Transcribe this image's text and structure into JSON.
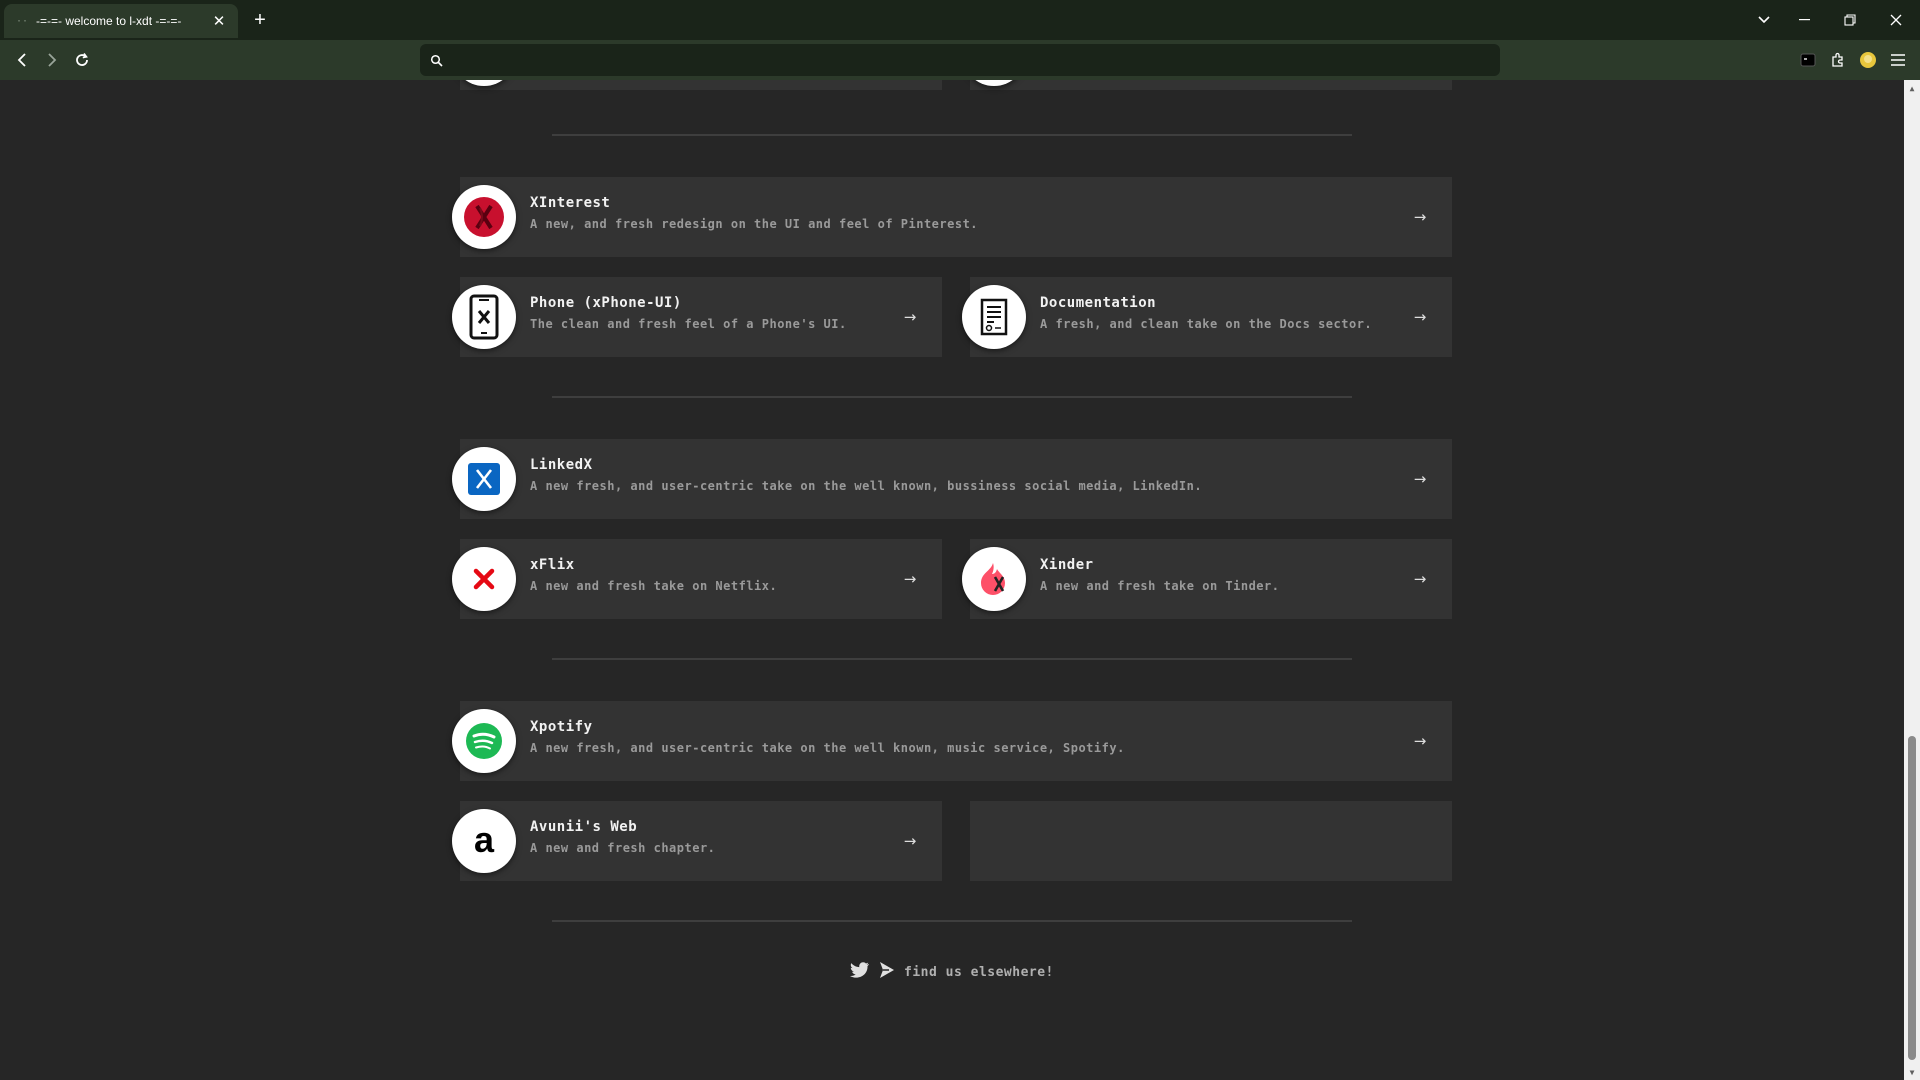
{
  "browser": {
    "tab_title": "-=-=- welcome to l-xdt -=-=-",
    "tab_favicon": "··",
    "new_tab_label": "+",
    "url_value": "",
    "url_placeholder": ""
  },
  "page": {
    "cards": [
      {
        "name": "xinterest",
        "title": "XInterest",
        "description": "A new, and fresh redesign on the UI and feel of Pinterest.",
        "icon": "xinterest-logo-icon"
      },
      {
        "name": "phone-xphone-ui",
        "title": "Phone (xPhone-UI)",
        "description": "The clean and fresh feel of a Phone's UI.",
        "icon": "phone-icon"
      },
      {
        "name": "documentation",
        "title": "Documentation",
        "description": "A fresh, and clean take on the Docs sector.",
        "icon": "document-icon"
      },
      {
        "name": "linkedx",
        "title": "LinkedX",
        "description": "A new fresh, and user-centric take on the well known, bussiness social media, LinkedIn.",
        "icon": "linkedx-logo-icon"
      },
      {
        "name": "xflix",
        "title": "xFlix",
        "description": "A new and fresh take on Netflix.",
        "icon": "xflix-logo-icon"
      },
      {
        "name": "xinder",
        "title": "Xinder",
        "description": "A new and fresh take on Tinder.",
        "icon": "xinder-logo-icon"
      },
      {
        "name": "xpotify",
        "title": "Xpotify",
        "description": "A new fresh, and user-centric take on the well known, music service, Spotify.",
        "icon": "spotify-logo-icon"
      },
      {
        "name": "avunii-web",
        "title": "Avunii's Web",
        "description": "A new and fresh chapter.",
        "icon": "avunii-logo-icon"
      }
    ],
    "footer_text": "find us elsewhere!"
  },
  "colors": {
    "background": "#262626",
    "card": "#333333",
    "chrome_dark": "#1a2419",
    "chrome": "#2c3a2a",
    "xinterest_red": "#c8102e",
    "linkedx_blue": "#0a66c2",
    "xflix_red": "#e50914",
    "xinder_pink": "#fd5068",
    "spotify_green": "#1db954"
  }
}
